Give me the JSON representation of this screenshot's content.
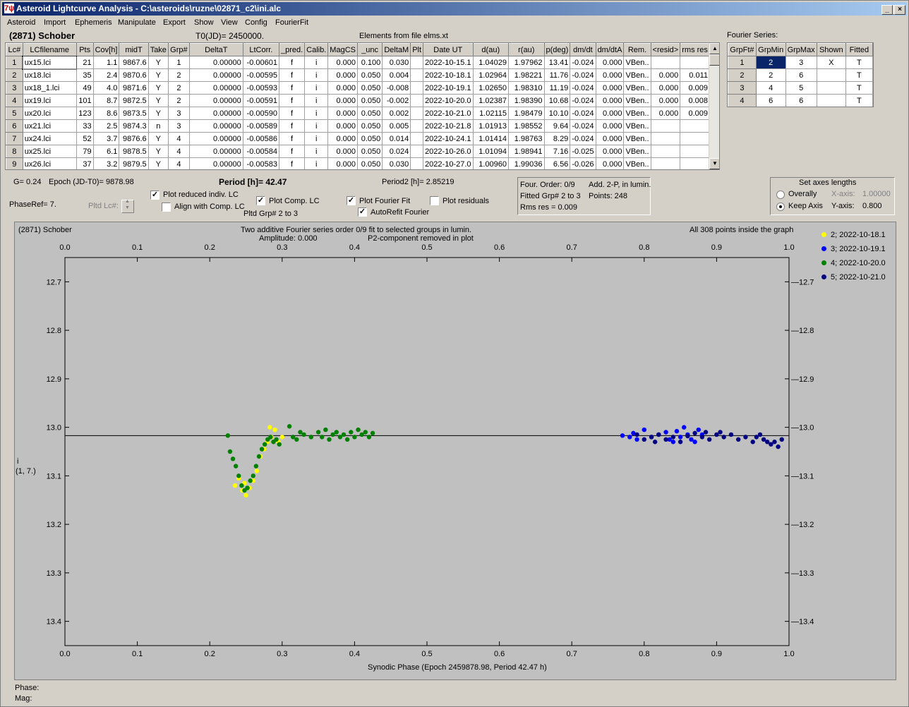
{
  "window": {
    "title": "Asteroid Lightcurve Analysis - C:\\asteroids\\ruzne\\02871_c2\\ini.alc",
    "app_icon": "7ψ"
  },
  "menu": [
    "Asteroid",
    "Import",
    "Ephemeris",
    "Manipulate",
    "Export",
    "Show",
    "View",
    "Config",
    "FourierFit"
  ],
  "header": {
    "object": "(2871) Schober",
    "t0": "T0(JD)= 2450000.",
    "elements": "Elements from file elms.xt",
    "fourier_series_label": "Fourier Series:"
  },
  "lc_table": {
    "columns": [
      "Lc#",
      "LCfilename",
      "Pts",
      "Cov[h]",
      "midT",
      "Take",
      "Grp#",
      "DeltaT",
      "LtCorr.",
      "_pred.",
      "Calib.",
      "MagCS",
      "_unc",
      "DeltaM",
      "Plt",
      "Date UT",
      "d(au)",
      "r(au)",
      "p(deg)",
      "dm/dt",
      "dm/dtA",
      "Rem.",
      "<resid>",
      "rms res"
    ],
    "rows": [
      [
        "1",
        "ux15.lci",
        "21",
        "1.1",
        "9867.6",
        "Y",
        "1",
        "0.00000",
        "-0.00601",
        "f",
        "i",
        "0.000",
        "0.100",
        "0.030",
        "",
        "2022-10-15.1",
        "1.04029",
        "1.97962",
        "13.41",
        "-0.024",
        "0.000",
        "VBen..",
        "",
        ""
      ],
      [
        "2",
        "ux18.lci",
        "35",
        "2.4",
        "9870.6",
        "Y",
        "2",
        "0.00000",
        "-0.00595",
        "f",
        "i",
        "0.000",
        "0.050",
        "0.004",
        "",
        "2022-10-18.1",
        "1.02964",
        "1.98221",
        "11.76",
        "-0.024",
        "0.000",
        "VBen..",
        "0.000",
        "0.011"
      ],
      [
        "3",
        "ux18_1.lci",
        "49",
        "4.0",
        "9871.6",
        "Y",
        "2",
        "0.00000",
        "-0.00593",
        "f",
        "i",
        "0.000",
        "0.050",
        "-0.008",
        "",
        "2022-10-19.1",
        "1.02650",
        "1.98310",
        "11.19",
        "-0.024",
        "0.000",
        "VBen..",
        "0.000",
        "0.009"
      ],
      [
        "4",
        "ux19.lci",
        "101",
        "8.7",
        "9872.5",
        "Y",
        "2",
        "0.00000",
        "-0.00591",
        "f",
        "i",
        "0.000",
        "0.050",
        "-0.002",
        "",
        "2022-10-20.0",
        "1.02387",
        "1.98390",
        "10.68",
        "-0.024",
        "0.000",
        "VBen..",
        "0.000",
        "0.008"
      ],
      [
        "5",
        "ux20.lci",
        "123",
        "8.6",
        "9873.5",
        "Y",
        "3",
        "0.00000",
        "-0.00590",
        "f",
        "i",
        "0.000",
        "0.050",
        "0.002",
        "",
        "2022-10-21.0",
        "1.02115",
        "1.98479",
        "10.10",
        "-0.024",
        "0.000",
        "VBen..",
        "0.000",
        "0.009"
      ],
      [
        "6",
        "ux21.lci",
        "33",
        "2.5",
        "9874.3",
        "n",
        "3",
        "0.00000",
        "-0.00589",
        "f",
        "i",
        "0.000",
        "0.050",
        "0.005",
        "",
        "2022-10-21.8",
        "1.01913",
        "1.98552",
        "9.64",
        "-0.024",
        "0.000",
        "VBen..",
        "",
        ""
      ],
      [
        "7",
        "ux24.lci",
        "52",
        "3.7",
        "9876.6",
        "Y",
        "4",
        "0.00000",
        "-0.00586",
        "f",
        "i",
        "0.000",
        "0.050",
        "0.014",
        "",
        "2022-10-24.1",
        "1.01414",
        "1.98763",
        "8.29",
        "-0.024",
        "0.000",
        "VBen..",
        "",
        ""
      ],
      [
        "8",
        "ux25.lci",
        "79",
        "6.1",
        "9878.5",
        "Y",
        "4",
        "0.00000",
        "-0.00584",
        "f",
        "i",
        "0.000",
        "0.050",
        "0.024",
        "",
        "2022-10-26.0",
        "1.01094",
        "1.98941",
        "7.16",
        "-0.025",
        "0.000",
        "VBen..",
        "",
        ""
      ],
      [
        "9",
        "ux26.lci",
        "37",
        "3.2",
        "9879.5",
        "Y",
        "4",
        "0.00000",
        "-0.00583",
        "f",
        "i",
        "0.000",
        "0.050",
        "0.030",
        "",
        "2022-10-27.0",
        "1.00960",
        "1.99036",
        "6.56",
        "-0.026",
        "0.000",
        "VBen..",
        "",
        ""
      ]
    ]
  },
  "fourier_table": {
    "columns": [
      "GrpFt#",
      "GrpMin",
      "GrpMax",
      "Shown",
      "Fitted"
    ],
    "rows": [
      [
        "1",
        "2",
        "3",
        "X",
        "T"
      ],
      [
        "2",
        "2",
        "6",
        "",
        "T"
      ],
      [
        "3",
        "4",
        "5",
        "",
        "T"
      ],
      [
        "4",
        "6",
        "6",
        "",
        "T"
      ]
    ]
  },
  "params": {
    "g": "G= 0.24",
    "epoch": "Epoch (JD-T0)= 9878.98",
    "period": "Period [h]= 42.47",
    "period2": "Period2 [h]= 2.85219",
    "phaseref": "PhaseRef= 7.",
    "pltd_lc": "Pltd Lc#:",
    "pltd_grp": "Pltd Grp#  2  to  3"
  },
  "checkboxes": {
    "plot_reduced": {
      "label": "Plot reduced indiv. LC",
      "checked": "✓"
    },
    "align_comp": {
      "label": "Align with Comp. LC",
      "checked": ""
    },
    "plot_comp": {
      "label": "Plot Comp. LC",
      "checked": "✓"
    },
    "plot_fourier": {
      "label": "Plot Fourier Fit",
      "checked": "✓"
    },
    "autorefit": {
      "label": "AutoRefit Fourier",
      "checked": "✓"
    },
    "plot_residuals": {
      "label": "Plot residuals",
      "checked": ""
    }
  },
  "fourier_info": {
    "order": "Four. Order:  0/9",
    "add": "Add. 2-P, in lumin.",
    "fitted": "Fitted Grp# 2 to 3",
    "points": "Points: 248",
    "rms": "Rms res     = 0.009"
  },
  "axes_panel": {
    "title": "Set axes lengths",
    "overally": "Overally",
    "keep_axis": "Keep Axis",
    "x_axis_label": "X-axis:",
    "x_axis_value": "1.00000",
    "y_axis_label": "Y-axis:",
    "y_axis_value": "0.800"
  },
  "plot": {
    "object": "(2871) Schober",
    "subtitle1": "Two additive Fourier series order 0/9 fit to selected groups in lumin.",
    "subtitle2": "Amplitude: 0.000",
    "subtitle3": "P2-component removed in plot",
    "inside": "All 308 points inside the graph",
    "ylabel1": "i",
    "ylabel2": "(1, 7.)",
    "xlabel": "Synodic Phase (Epoch 2459878.98, Period 42.47 h)"
  },
  "chart_data": {
    "type": "scatter",
    "xlim": [
      0.0,
      1.0
    ],
    "ylim": [
      13.45,
      12.65
    ],
    "y_inverted": true,
    "x_ticks": [
      "0.0",
      "0.1",
      "0.2",
      "0.3",
      "0.4",
      "0.5",
      "0.6",
      "0.7",
      "0.8",
      "0.9",
      "1.0"
    ],
    "y_ticks": [
      "12.7",
      "12.8",
      "12.9",
      "13.0",
      "13.1",
      "13.2",
      "13.3",
      "13.4"
    ],
    "fit_line_y": 13.017,
    "legend": [
      {
        "name": "2; 2022-10-18.1",
        "color": "#ffff00"
      },
      {
        "name": "3; 2022-10-19.1",
        "color": "#0000ff"
      },
      {
        "name": "4; 2022-10-20.0",
        "color": "#008000"
      },
      {
        "name": "5; 2022-10-21.0",
        "color": "#000080"
      }
    ],
    "series": [
      {
        "name": "2; 2022-10-18.1",
        "color": "#ffff00",
        "points": [
          [
            0.235,
            13.12
          ],
          [
            0.24,
            13.105
          ],
          [
            0.245,
            13.13
          ],
          [
            0.25,
            13.14
          ],
          [
            0.248,
            13.115
          ],
          [
            0.255,
            13.125
          ],
          [
            0.26,
            13.11
          ],
          [
            0.265,
            13.09
          ],
          [
            0.27,
            13.06
          ],
          [
            0.275,
            13.045
          ],
          [
            0.28,
            13.03
          ],
          [
            0.285,
            13.02
          ],
          [
            0.29,
            13.005
          ],
          [
            0.295,
            13.03
          ],
          [
            0.3,
            13.02
          ],
          [
            0.283,
            13.0
          ]
        ]
      },
      {
        "name": "3; 2022-10-19.1",
        "color": "#0000ff",
        "points": [
          [
            0.77,
            13.017
          ],
          [
            0.78,
            13.02
          ],
          [
            0.785,
            13.012
          ],
          [
            0.79,
            13.025
          ],
          [
            0.8,
            13.005
          ],
          [
            0.81,
            13.02
          ],
          [
            0.82,
            13.015
          ],
          [
            0.83,
            13.01
          ],
          [
            0.835,
            13.025
          ],
          [
            0.84,
            13.03
          ],
          [
            0.845,
            13.008
          ],
          [
            0.85,
            13.02
          ],
          [
            0.855,
            13.0
          ],
          [
            0.86,
            13.015
          ],
          [
            0.865,
            13.025
          ],
          [
            0.87,
            13.03
          ],
          [
            0.875,
            13.005
          ],
          [
            0.88,
            13.015
          ]
        ]
      },
      {
        "name": "4; 2022-10-20.0",
        "color": "#008000",
        "points": [
          [
            0.225,
            13.017
          ],
          [
            0.228,
            13.05
          ],
          [
            0.232,
            13.065
          ],
          [
            0.236,
            13.08
          ],
          [
            0.24,
            13.1
          ],
          [
            0.244,
            13.12
          ],
          [
            0.248,
            13.13
          ],
          [
            0.252,
            13.125
          ],
          [
            0.256,
            13.11
          ],
          [
            0.26,
            13.1
          ],
          [
            0.264,
            13.08
          ],
          [
            0.268,
            13.06
          ],
          [
            0.272,
            13.045
          ],
          [
            0.276,
            13.035
          ],
          [
            0.28,
            13.025
          ],
          [
            0.284,
            13.02
          ],
          [
            0.288,
            13.03
          ],
          [
            0.292,
            13.025
          ],
          [
            0.296,
            13.035
          ],
          [
            0.31,
            12.998
          ],
          [
            0.315,
            13.02
          ],
          [
            0.32,
            13.025
          ],
          [
            0.325,
            13.01
          ],
          [
            0.33,
            13.015
          ],
          [
            0.34,
            13.02
          ],
          [
            0.35,
            13.01
          ],
          [
            0.355,
            13.02
          ],
          [
            0.36,
            13.005
          ],
          [
            0.365,
            13.025
          ],
          [
            0.37,
            13.015
          ],
          [
            0.375,
            13.01
          ],
          [
            0.38,
            13.02
          ],
          [
            0.385,
            13.015
          ],
          [
            0.39,
            13.025
          ],
          [
            0.395,
            13.01
          ],
          [
            0.4,
            13.02
          ],
          [
            0.405,
            13.005
          ],
          [
            0.41,
            13.015
          ],
          [
            0.415,
            13.01
          ],
          [
            0.42,
            13.02
          ],
          [
            0.425,
            13.012
          ]
        ]
      },
      {
        "name": "5; 2022-10-21.0",
        "color": "#000080",
        "points": [
          [
            0.79,
            13.015
          ],
          [
            0.8,
            13.025
          ],
          [
            0.81,
            13.02
          ],
          [
            0.815,
            13.03
          ],
          [
            0.82,
            13.015
          ],
          [
            0.83,
            13.025
          ],
          [
            0.84,
            13.02
          ],
          [
            0.85,
            13.03
          ],
          [
            0.86,
            13.018
          ],
          [
            0.87,
            13.012
          ],
          [
            0.88,
            13.02
          ],
          [
            0.885,
            13.01
          ],
          [
            0.89,
            13.025
          ],
          [
            0.9,
            13.015
          ],
          [
            0.905,
            13.01
          ],
          [
            0.91,
            13.02
          ],
          [
            0.92,
            13.015
          ],
          [
            0.93,
            13.025
          ],
          [
            0.94,
            13.02
          ],
          [
            0.95,
            13.03
          ],
          [
            0.955,
            13.02
          ],
          [
            0.96,
            13.015
          ],
          [
            0.965,
            13.025
          ],
          [
            0.97,
            13.03
          ],
          [
            0.975,
            13.035
          ],
          [
            0.98,
            13.03
          ],
          [
            0.985,
            13.04
          ],
          [
            0.99,
            13.025
          ]
        ]
      }
    ]
  },
  "status": {
    "phase": "Phase:",
    "mag": "Mag:"
  }
}
